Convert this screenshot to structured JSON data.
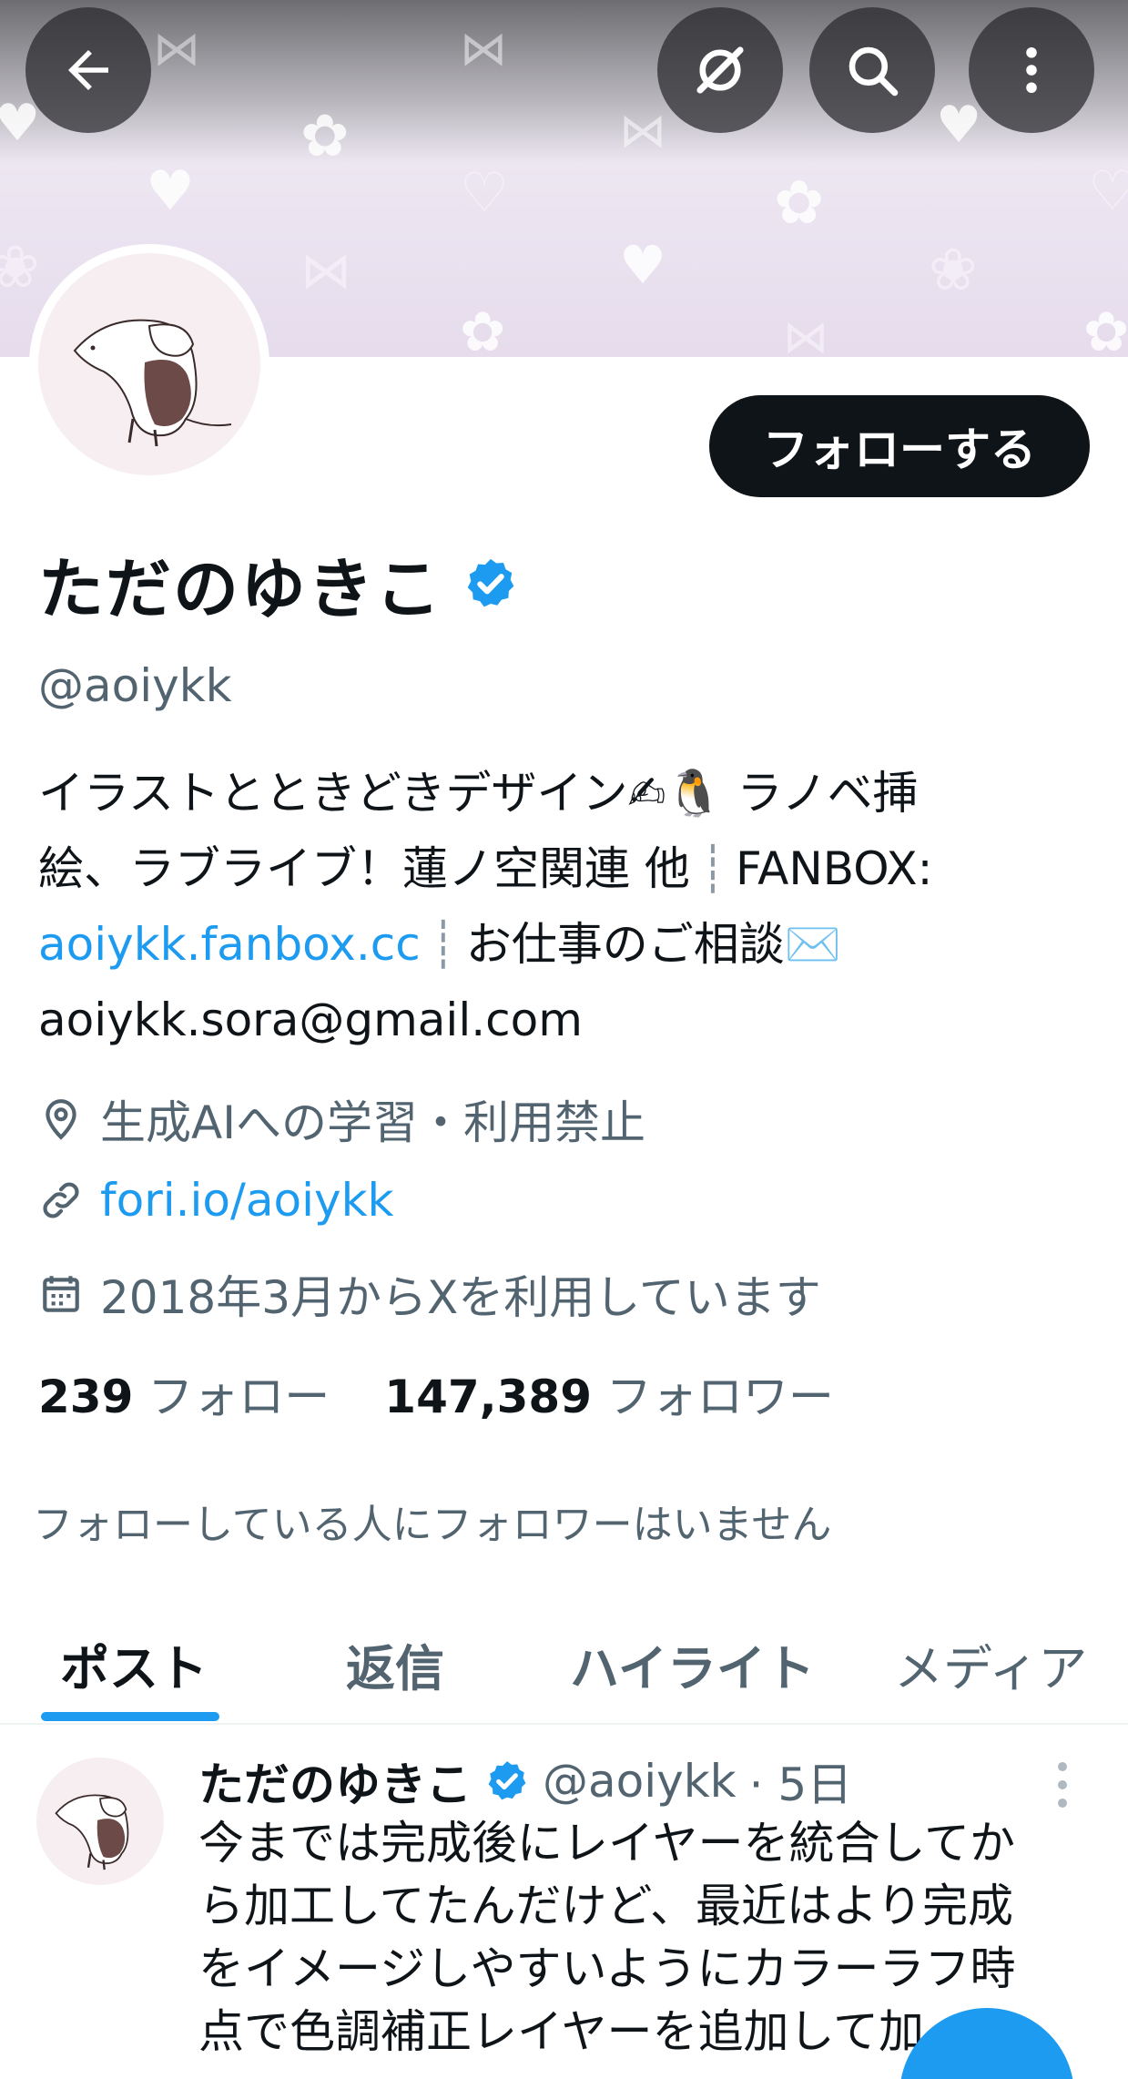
{
  "header": {
    "back_label": "Back",
    "grok_label": "Grok",
    "search_label": "Search",
    "more_label": "More"
  },
  "profile": {
    "follow_button": "フォローする",
    "display_name": "ただのゆきこ",
    "verified": true,
    "handle": "@aoiykk",
    "bio_lines": [
      [
        "イラストとときどきデザイン✍🐧 ラノベ挿"
      ],
      [
        "絵、ラブライブ！蓮ノ空関連 他",
        "┊",
        "FANBOX:"
      ],
      [
        "aoiykk.fanbox.cc",
        "┊",
        "お仕事のご相談✉️"
      ],
      [
        "aoiykk.sora@gmail.com"
      ]
    ],
    "location": "生成AIへの学習・利用禁止",
    "website": "fori.io/aoiykk",
    "joined": "2018年3月からXを利用しています",
    "following_count": "239",
    "following_label": "フォロー",
    "followers_count": "147,389",
    "followers_label": "フォロワー",
    "mutual_note": "フォローしている人にフォロワーはいません"
  },
  "tabs": [
    {
      "label": "ポスト",
      "active": true
    },
    {
      "label": "返信",
      "active": false
    },
    {
      "label": "ハイライト",
      "active": false
    },
    {
      "label": "メディア",
      "active": false
    }
  ],
  "post": {
    "name": "ただのゆきこ",
    "handle": "@aoiykk",
    "time": "· 5日",
    "lines": [
      "今までは完成後にレイヤーを統合してか",
      "ら加工してたんだけど、最近はより完成",
      "をイメージしやすいようにカラーラフ時",
      "点で色調補正レイヤーを追加して加"
    ]
  },
  "colors": {
    "accent": "#1d9bf0",
    "text": "#0f1419",
    "secondary_text": "#536471",
    "follow_bg": "#0f1419"
  }
}
